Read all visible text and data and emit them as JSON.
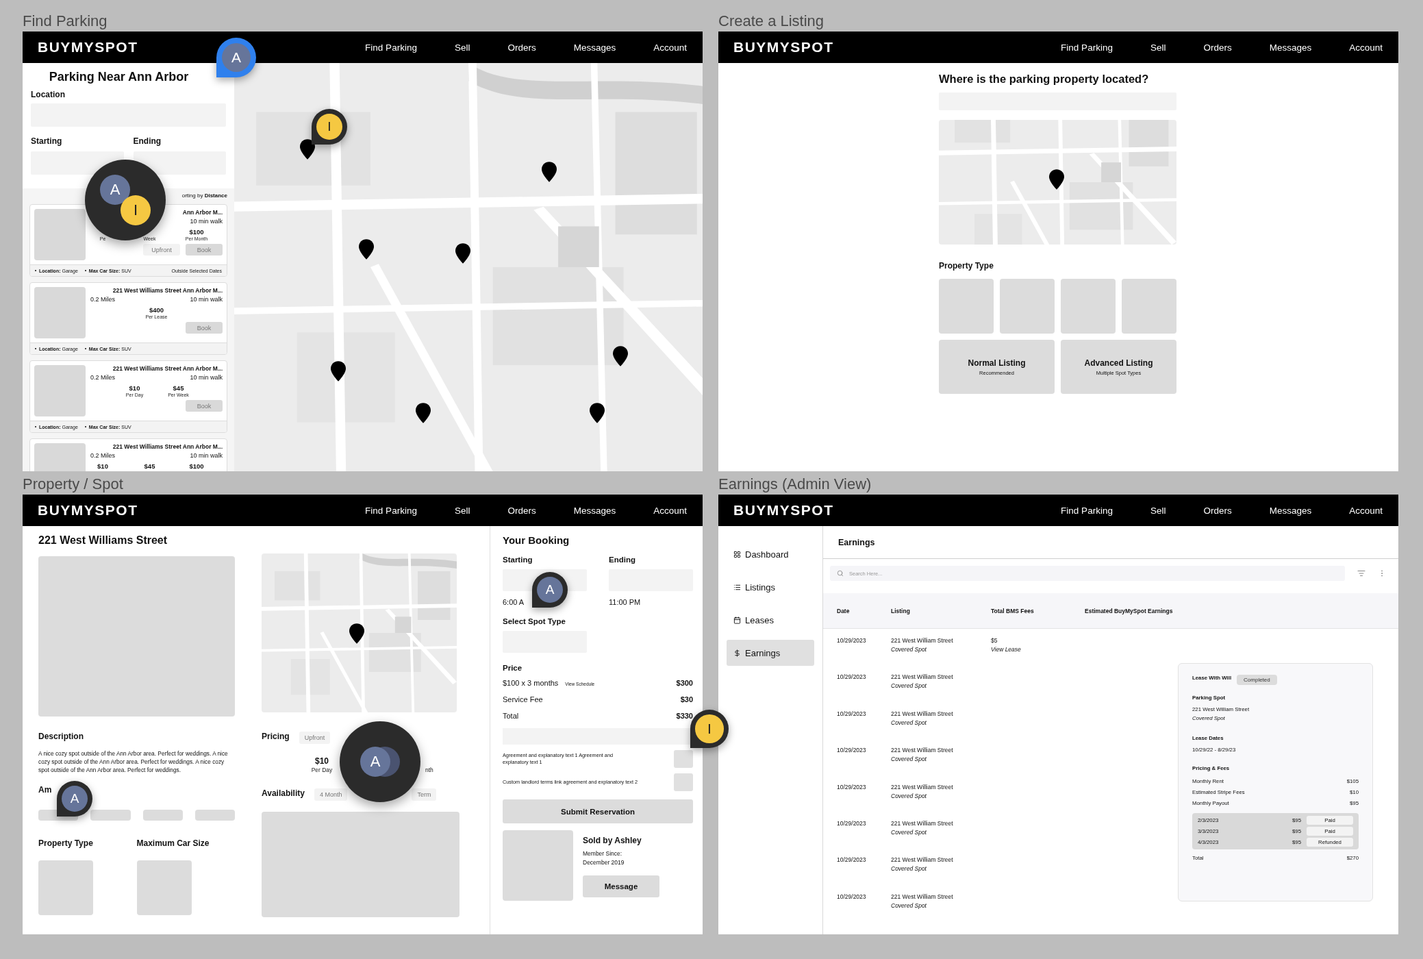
{
  "find_parking": {
    "frame_label": "Find Parking",
    "header": {
      "logo": "BUYMYSPOT",
      "nav": [
        "Find Parking",
        "Sell",
        "Orders",
        "Messages",
        "Account"
      ]
    },
    "title": "Parking Near Ann Arbor",
    "location_label": "Location",
    "starting_label": "Starting",
    "ending_label": "Ending",
    "sorting": "orting by **Distance**",
    "results": [
      {
        "title": "Ann Arbor M...",
        "walk": "10 min walk",
        "prices": [
          {
            "unit": "Pe"
          },
          {
            "unit": "Week"
          },
          {
            "amount": "$100",
            "unit": "Per Month"
          }
        ],
        "buttons": [
          {
            "kind": "chip",
            "label": "Upfront"
          },
          {
            "kind": "button",
            "label": "Book"
          }
        ],
        "details": [
          "**Location:** Garage",
          "**Max Car Size:** SUV"
        ],
        "note": "Outside Selected Dates"
      },
      {
        "title": "221 West Williams Street Ann Arbor M...",
        "distance": "0.2 Miles",
        "walk": "10 min walk",
        "prices": [
          {
            "amount": "$400",
            "unit": "Per Lease"
          }
        ],
        "buttons": [
          {
            "kind": "button",
            "label": "Book"
          }
        ],
        "details": [
          "**Location:** Garage",
          "**Max Car Size:** SUV"
        ]
      },
      {
        "title": "221 West Williams Street Ann Arbor M...",
        "distance": "0.2 Miles",
        "walk": "10 min walk",
        "prices": [
          {
            "amount": "$10",
            "unit": "Per Day"
          },
          {
            "amount": "$45",
            "unit": "Per Week"
          }
        ],
        "buttons": [
          {
            "kind": "button",
            "label": "Book"
          }
        ],
        "details": [
          "**Location:** Garage",
          "**Max Car Size:** SUV"
        ]
      },
      {
        "title": "221 West Williams Street Ann Arbor M...",
        "distance": "0.2 Miles",
        "walk": "10 min walk",
        "prices": [
          {
            "amount": "$10"
          },
          {
            "amount": "$45"
          },
          {
            "amount": "$100"
          }
        ]
      }
    ],
    "map": {
      "kind": "picture"
    },
    "cursors": [
      {
        "kind": "single",
        "initial": "A",
        "color": "#66759a",
        "selected": true
      },
      {
        "kind": "single",
        "initial": "I",
        "color": "#f5c842",
        "selected": false
      },
      {
        "kind": "cluster",
        "selected": false,
        "members": [
          {
            "initial": "A",
            "color": "#66759a"
          },
          {
            "initial": "I",
            "color": "#f5c842"
          }
        ]
      }
    ]
  },
  "create_listing": {
    "frame_label": "Create a Listing",
    "header": {
      "logo": "BUYMYSPOT",
      "nav": [
        "Find Parking",
        "Sell",
        "Orders",
        "Messages",
        "Account"
      ]
    },
    "question": "Where is the parking property located?",
    "map": {
      "kind": "picture"
    },
    "property_type_label": "Property Type",
    "listing_options": [
      {
        "title": "Normal Listing",
        "subtitle": "Recommended"
      },
      {
        "title": "Advanced Listing",
        "subtitle": "Multiple Spot Types"
      }
    ]
  },
  "property_spot": {
    "frame_label": "Property / Spot",
    "header": {
      "logo": "BUYMYSPOT",
      "nav": [
        "Find Parking",
        "Sell",
        "Orders",
        "Messages",
        "Account"
      ]
    },
    "title": "221 West Williams Street",
    "description_label": "Description",
    "description": "A nice cozy spot outside of the Ann Arbor area. Perfect for weddings. A nice cozy spot outside of the Ann Arbor area. Perfect for weddings. A nice cozy spot outside of the Ann Arbor area. Perfect for weddings.",
    "amenities_label": "Am",
    "property_type_label": "Property Type",
    "max_car_size_label": "Maximum Car Size",
    "map": {
      "kind": "picture"
    },
    "pricing_label": "Pricing",
    "pricing_chip": "Upfront",
    "prices": [
      {
        "amount": "$10",
        "unit": "Per Day"
      },
      {
        "unit": "nth"
      }
    ],
    "availability_label": "Availability",
    "availability_chip": [
      "4 Month",
      "Term"
    ],
    "booking": {
      "title": "Your Booking",
      "starting_label": "Starting",
      "ending_label": "Ending",
      "starting_time": "6:00 A",
      "ending_time": "11:00 PM",
      "spot_type_label": "Select Spot Type",
      "price_label": "Price",
      "lines": [
        {
          "label": "$100 x 3 months",
          "link": "View Schedule",
          "amount": "$300"
        },
        {
          "label": "Service Fee",
          "amount": "$30"
        },
        {
          "label": "Total",
          "amount": "$330"
        }
      ],
      "agreements": [
        {
          "text": "Agreement and explanatory text 1 Agreement and explanatory text 1",
          "checked": false
        },
        {
          "text": "Custom landlord terms link agreement and explanatory text 2",
          "checked": false
        }
      ],
      "submit": "Submit Reservation",
      "seller": {
        "name": "Sold by Ashley",
        "member_since": "Member Since: December 2019",
        "message": "Message"
      }
    },
    "cursors": [
      {
        "kind": "single",
        "initial": "A",
        "color": "#66759a",
        "selected": false
      },
      {
        "kind": "single",
        "initial": "A",
        "color": "#66759a",
        "selected": false
      },
      {
        "kind": "cluster",
        "selected": false,
        "members": [
          {
            "color": "#4a5370"
          },
          {
            "initial": "A",
            "color": "#66759a"
          }
        ]
      }
    ]
  },
  "earnings": {
    "frame_label": "Earnings (Admin View)",
    "header": {
      "logo": "BUYMYSPOT",
      "nav": [
        "Find Parking",
        "Sell",
        "Orders",
        "Messages",
        "Account"
      ]
    },
    "sidebar": [
      {
        "kind": "dashboard",
        "label": "Dashboard",
        "selected": false
      },
      {
        "kind": "listings",
        "label": "Listings",
        "selected": false
      },
      {
        "kind": "leases",
        "label": "Leases",
        "selected": false
      },
      {
        "kind": "earnings",
        "label": "Earnings",
        "selected": true
      }
    ],
    "heading": "Earnings",
    "search_placeholder": "Search Here...",
    "columns": [
      "Date",
      "Listing",
      "Total BMS Fees",
      "Estimated BuyMySpot Earnings"
    ],
    "rows": [
      {
        "date": "10/29/2023",
        "listing": "221 West William Street",
        "spot": "Covered Spot",
        "fee": "$5",
        "fee_link": "View Lease"
      },
      {
        "date": "10/29/2023",
        "listing": "221 West William Street",
        "spot": "Covered Spot"
      },
      {
        "date": "10/29/2023",
        "listing": "221 West William Street",
        "spot": "Covered Spot"
      },
      {
        "date": "10/29/2023",
        "listing": "221 West William Street",
        "spot": "Covered Spot"
      },
      {
        "date": "10/29/2023",
        "listing": "221 West William Street",
        "spot": "Covered Spot"
      },
      {
        "date": "10/29/2023",
        "listing": "221 West William Street",
        "spot": "Covered Spot"
      },
      {
        "date": "10/29/2023",
        "listing": "221 West William Street",
        "spot": "Covered Spot"
      },
      {
        "date": "10/29/2023",
        "listing": "221 West William Street",
        "spot": "Covered Spot"
      }
    ],
    "detail": {
      "title": "Lease With Will",
      "status": "Completed",
      "parking_spot_label": "Parking Spot",
      "address": "221 West William Street",
      "spot": "Covered Spot",
      "lease_dates_label": "Lease Dates",
      "lease_dates": "10/29/22 - 8/29/23",
      "pricing_label": "Pricing & Fees",
      "fees": [
        {
          "label": "Monthly Rent",
          "amount": "$105"
        },
        {
          "label": "Estimated Stripe Fees",
          "amount": "$10"
        },
        {
          "label": "Monthly Payout",
          "amount": "$95"
        }
      ],
      "payments": [
        {
          "date": "2/3/2023",
          "amount": "$95",
          "status": "Paid"
        },
        {
          "date": "3/3/2023",
          "amount": "$95",
          "status": "Paid"
        },
        {
          "date": "4/3/2023",
          "amount": "$95",
          "status": "Refunded"
        }
      ],
      "total_label": "Total",
      "total": "$270"
    }
  },
  "canvas_cursors": [
    {
      "kind": "single",
      "initial": "I",
      "color": "#f5c842",
      "selected": false
    }
  ]
}
